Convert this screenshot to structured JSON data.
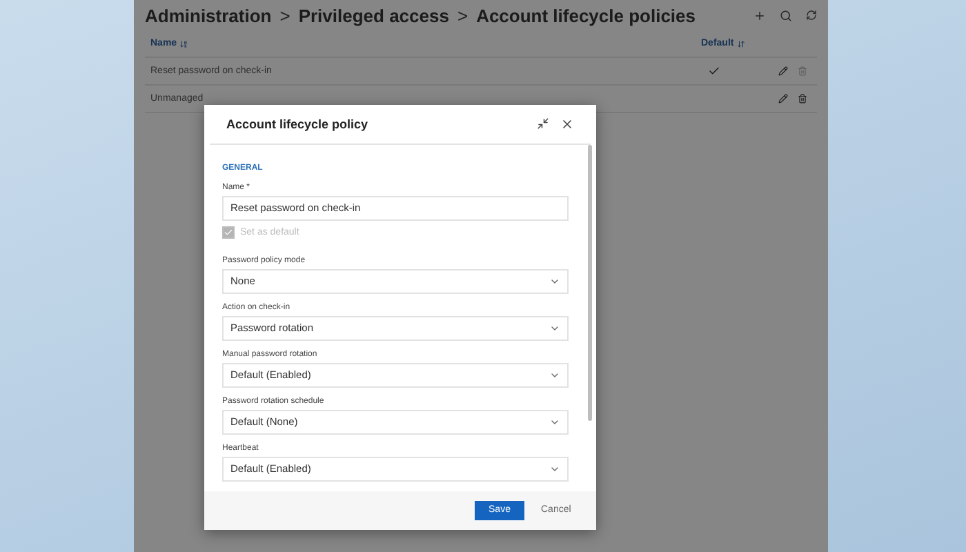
{
  "breadcrumb": [
    {
      "label": "Administration"
    },
    {
      "separator": ">",
      "label": "Privileged access"
    },
    {
      "separator": ">",
      "label": "Account lifecycle policies"
    }
  ],
  "table": {
    "columns": [
      {
        "label": "Name"
      },
      {
        "label": "Default"
      }
    ],
    "rows": [
      {
        "name": "Reset password on check-in",
        "default": true,
        "delete_disabled": true
      },
      {
        "name": "Unmanaged",
        "default": false,
        "delete_disabled": false
      }
    ]
  },
  "dialog": {
    "title": "Account lifecycle policy",
    "section": "GENERAL",
    "name_field": {
      "label": "Name *",
      "value": "Reset password on check-in"
    },
    "default_checkbox": {
      "label": "Set as default",
      "checked": true,
      "disabled": true
    },
    "selects": [
      {
        "label": "Password policy mode",
        "value": "None"
      },
      {
        "label": "Action on check-in",
        "value": "Password rotation"
      },
      {
        "label": "Manual password rotation",
        "value": "Default (Enabled)"
      },
      {
        "label": "Password rotation schedule",
        "value": "Default (None)"
      },
      {
        "label": "Heartbeat",
        "value": "Default (Enabled)"
      }
    ],
    "buttons": [
      {
        "label": "Save",
        "primary": true
      },
      {
        "label": "Cancel",
        "primary": false
      }
    ]
  }
}
